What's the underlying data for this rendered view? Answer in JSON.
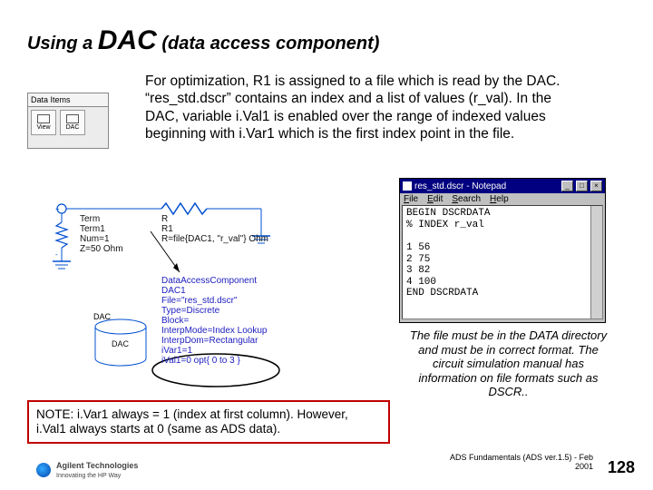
{
  "title": {
    "pre": "Using a ",
    "big": "DAC",
    "post": " (data access component)"
  },
  "intro": "For optimization, R1 is assigned to a file which is read by the DAC.  “res_std.dscr” contains an index and a list of values (r_val).  In the DAC,  variable i.Val1 is enabled over the range of indexed values beginning with i.Var1 which is the  first index point in the file.",
  "data_items": {
    "header": "Data Items",
    "icon1": "View",
    "icon2": "DAC"
  },
  "schematic": {
    "term_label": "Term\nTerm1\nNum=1\nZ=50 Ohm",
    "r_label": "R\nR1\nR=file{DAC1, \"r_val\"} Ohm",
    "blue": "DataAccessComponent\nDAC1\nFile=\"res_std.dscr\"\nType=Discrete\nBlock=\nInterpMode=Index Lookup\nInterpDom=Rectangular\niVar1=1\niVal1=0 opt{ 0 to 3 }",
    "dac": "DAC",
    "dac_small": "DAC"
  },
  "note": "NOTE: i.Var1 always = 1 (index at first column). However, i.Val1 always starts at 0 (same as ADS data).",
  "notepad": {
    "title": "res_std.dscr - Notepad",
    "menu": {
      "file": "File",
      "edit": "Edit",
      "search": "Search",
      "help": "Help"
    },
    "content": "BEGIN DSCRDATA\n% INDEX r_val\n\n1 56\n2 75\n3 82\n4 100\nEND DSCRDATA"
  },
  "side_note": "The file must be in the DATA directory and must be in correct format. The circuit simulation manual has information on file formats such as DSCR..",
  "footer": {
    "brand": "Agilent Technologies",
    "tagline": "Innovating the HP Way",
    "right": "ADS Fundamentals (ADS ver.1.5) - Feb 2001",
    "page": "128"
  }
}
